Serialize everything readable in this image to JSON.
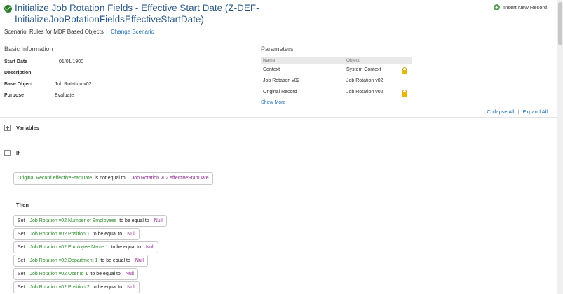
{
  "header": {
    "title": "Initialize Job Rotation Fields - Effective Start Date (Z-DEF-InitializeJobRotationFieldsEffectiveStartDate)",
    "insert_label": "Insert New Record"
  },
  "scenario": {
    "text": "Scenario: Rules for MDF Based Objects",
    "change_label": "Change Scenario"
  },
  "basic_info": {
    "title": "Basic Information",
    "rows": [
      {
        "label": "Start Date",
        "value": "01/01/1900"
      },
      {
        "label": "Description",
        "value": ""
      },
      {
        "label": "Base Object",
        "value": "Job Rotation v02"
      },
      {
        "label": "Purpose",
        "value": "Evaluate"
      }
    ]
  },
  "parameters": {
    "title": "Parameters",
    "col_name": "Name",
    "col_object": "Object",
    "rows": [
      {
        "name": "Context",
        "object": "System Context",
        "locked": true
      },
      {
        "name": "Job Rotation v02",
        "object": "Job Rotation v02",
        "locked": false
      },
      {
        "name": "Original Record",
        "object": "Job Rotation v02",
        "locked": true
      }
    ],
    "show_more": "Show More"
  },
  "controls": {
    "collapse_all": "Collapse All",
    "separator": "|",
    "expand_all": "Expand All"
  },
  "variables": {
    "label": "Variables"
  },
  "if_section": {
    "label": "If",
    "condition": {
      "left": "Original Record.effectiveStartDate",
      "operator": "is not equal to",
      "right": "Job Rotation v02.effectiveStartDate"
    }
  },
  "then_section": {
    "label": "Then",
    "set_keyword": "Set",
    "operator": "to be equal to",
    "rows": [
      {
        "field": "Job Rotation v02.Number of Employees",
        "value": "Null"
      },
      {
        "field": "Job Rotation v02.Position 1",
        "value": "Null"
      },
      {
        "field": "Job Rotation v02.Employee Name 1",
        "value": "Null"
      },
      {
        "field": "Job Rotation v02.Department 1",
        "value": "Null"
      },
      {
        "field": "Job Rotation v02.User Id 1",
        "value": "Null"
      },
      {
        "field": "Job Rotation v02.Position 2",
        "value": "Null"
      }
    ]
  }
}
